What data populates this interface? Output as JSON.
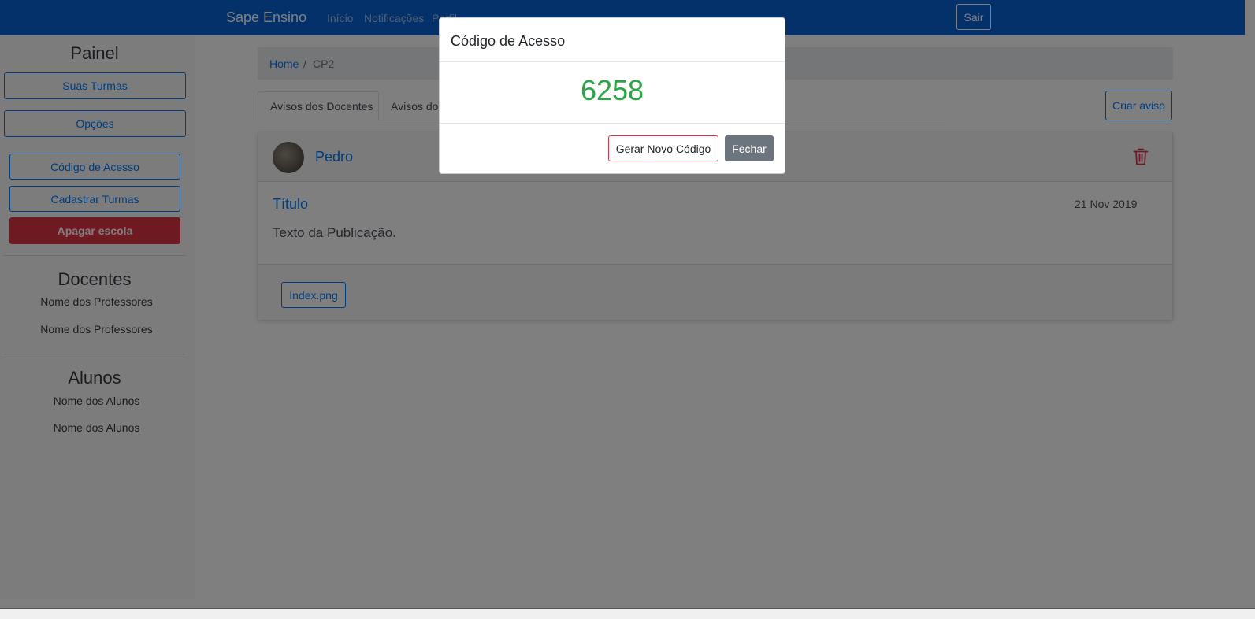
{
  "navbar": {
    "brand": "Sape Ensino",
    "links": [
      "Início",
      "Notificações",
      "Perfil"
    ],
    "logout_label": "Sair"
  },
  "sidebar": {
    "title": "Painel",
    "buttons": [
      "Suas Turmas",
      "Opções",
      "Código de Acesso",
      "Cadastrar Turmas"
    ],
    "danger_button": "Apagar escola",
    "teachers_heading": "Docentes",
    "teachers": [
      "Nome dos Professores",
      "Nome dos Professores"
    ],
    "students_heading": "Alunos",
    "students": [
      "Nome dos Alunos",
      "Nome dos Alunos"
    ]
  },
  "breadcrumb": {
    "home": "Home",
    "separator": "/",
    "current": "CP2"
  },
  "tabs": [
    "Avisos dos Docentes",
    "Avisos dos"
  ],
  "create_notice_label": "Criar aviso",
  "post": {
    "author": "Pedro",
    "title": "Título",
    "date": "21 Nov 2019",
    "text": "Texto da Publicação.",
    "attachment": "Index.png"
  },
  "modal": {
    "title": "Código de Acesso",
    "code": "6258",
    "generate_label": "Gerar Novo Código",
    "close_label": "Fechar"
  },
  "colors": {
    "navbar": "#0a63d6",
    "primary": "#007bff",
    "danger": "#dc3545",
    "success": "#28a745",
    "secondary": "#6c757d"
  }
}
